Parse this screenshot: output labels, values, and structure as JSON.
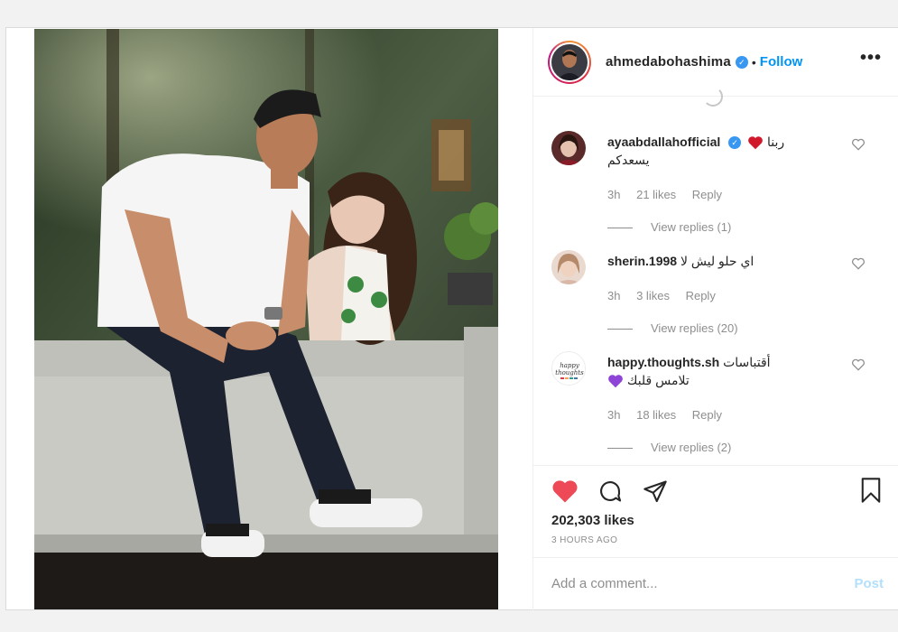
{
  "post": {
    "image_alt": "Couple sitting on a grey sofa outdoors",
    "author": {
      "username": "ahmedabohashima",
      "verified": true,
      "separator": "•",
      "follow_label": "Follow",
      "more_icon": "more-options-icon",
      "more_label": "•••"
    },
    "comments": [
      {
        "username": "ayaabdallahofficial",
        "verified": true,
        "text_part1": "ربنا",
        "emoji": "red-heart",
        "text_part2": "يسعدكم",
        "time": "3h",
        "likes": "21 likes",
        "reply_label": "Reply",
        "view_replies": "View replies (1)"
      },
      {
        "username": "sherin.1998",
        "verified": false,
        "text_part1": "اي حلو ليش لا",
        "time": "3h",
        "likes": "3 likes",
        "reply_label": "Reply",
        "view_replies": "View replies (20)"
      },
      {
        "username": "happy.thoughts.sh",
        "verified": false,
        "text_part1": "أقتباسات",
        "emoji": "purple-heart",
        "text_part2": "تلامس قلبك",
        "time": "3h",
        "likes": "18 likes",
        "reply_label": "Reply",
        "view_replies": "View replies (2)",
        "avatar_text": "happy thoughts"
      }
    ],
    "actions": {
      "liked": true,
      "like_color": "#ed4956",
      "icons": [
        "heart-icon",
        "comment-icon",
        "share-icon",
        "bookmark-icon"
      ]
    },
    "likes_count": "202,303 likes",
    "timestamp": "3 HOURS AGO",
    "add_comment": {
      "placeholder": "Add a comment...",
      "post_label": "Post"
    }
  }
}
